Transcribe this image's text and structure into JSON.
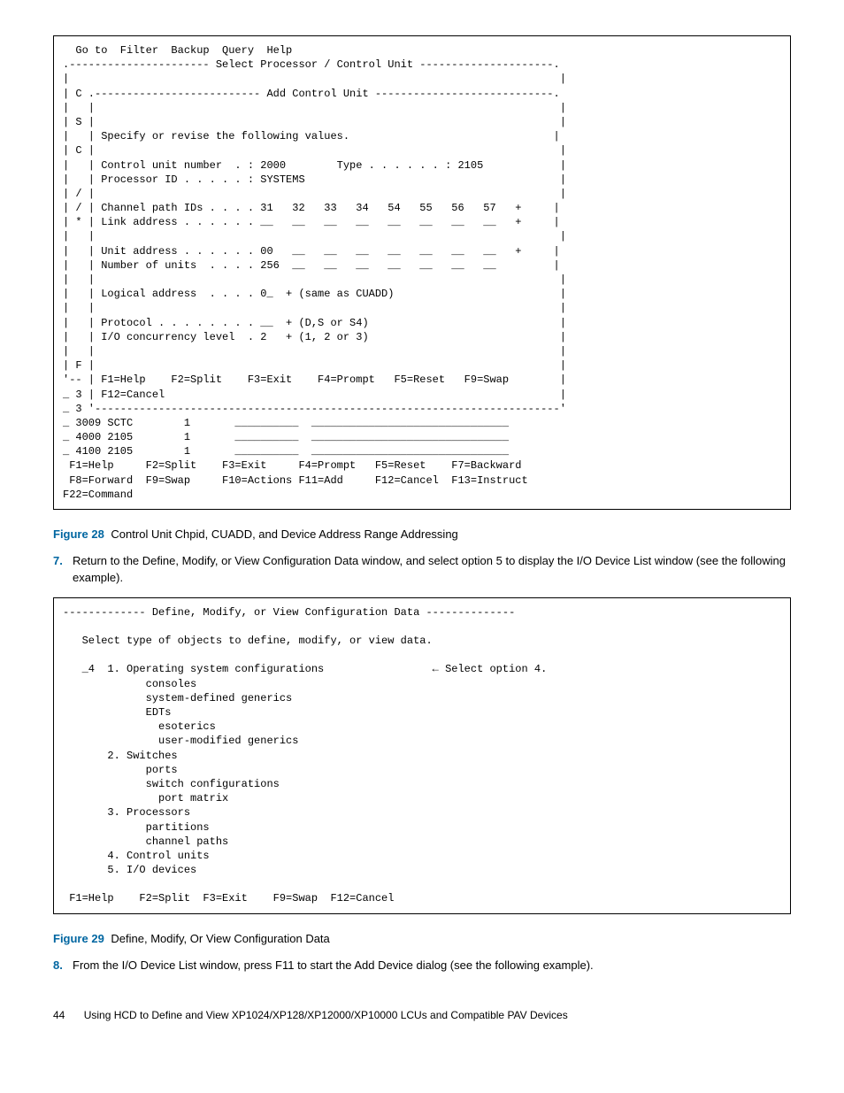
{
  "figure28": {
    "content": "  Go to  Filter  Backup  Query  Help\n.---------------------- Select Processor / Control Unit ---------------------.\n|                                                                             |\n| C .-------------------------- Add Control Unit ----------------------------.\n|   |                                                                         |\n| S |                                                                         |\n|   | Specify or revise the following values.                                |\n| C |                                                                         |\n|   | Control unit number  . : 2000        Type . . . . . . : 2105            |\n|   | Processor ID . . . . . : SYSTEMS                                        |\n| / |                                                                         |\n| / | Channel path IDs . . . . 31   32   33   34   54   55   56   57   +     |\n| * | Link address . . . . . . __   __   __   __   __   __   __   __   +     |\n|   |                                                                         |\n|   | Unit address . . . . . . 00   __   __   __   __   __   __   __   +     |\n|   | Number of units  . . . . 256  __   __   __   __   __   __   __         |\n|   |                                                                         |\n|   | Logical address  . . . . 0_  + (same as CUADD)                          |\n|   |                                                                         |\n|   | Protocol . . . . . . . . __  + (D,S or S4)                              |\n|   | I/O concurrency level  . 2   + (1, 2 or 3)                              |\n|   |                                                                         |\n| F |                                                                         |\n'-- | F1=Help    F2=Split    F3=Exit    F4=Prompt   F5=Reset   F9=Swap        |\n_ 3 | F12=Cancel                                                              |\n_ 3 '-------------------------------------------------------------------------'\n_ 3009 SCTC        1       __________  _______________________________\n_ 4000 2105        1       __________  _______________________________\n_ 4100 2105        1       __________  _______________________________\n F1=Help     F2=Split    F3=Exit     F4=Prompt   F5=Reset    F7=Backward\n F8=Forward  F9=Swap     F10=Actions F11=Add     F12=Cancel  F13=Instruct\nF22=Command",
    "label": "Figure 28",
    "caption": "Control Unit Chpid, CUADD, and Device Address Range Addressing"
  },
  "step7": {
    "number": "7.",
    "text": "Return to the Define, Modify, or View Configuration Data window, and select option 5 to display the I/O Device List window (see the following example)."
  },
  "figure29": {
    "content": "------------- Define, Modify, or View Configuration Data --------------\n\n   Select type of objects to define, modify, or view data.\n\n   _4  1. Operating system configurations                 ← Select option 4.\n             consoles\n             system-defined generics\n             EDTs\n               esoterics\n               user-modified generics\n       2. Switches\n             ports\n             switch configurations\n               port matrix\n       3. Processors\n             partitions\n             channel paths\n       4. Control units\n       5. I/O devices\n\n F1=Help    F2=Split  F3=Exit    F9=Swap  F12=Cancel",
    "label": "Figure 29",
    "caption": "Define, Modify, Or View Configuration Data"
  },
  "step8": {
    "number": "8.",
    "text": "From the I/O Device List window, press F11 to start the Add Device dialog (see the following example)."
  },
  "footer": {
    "page_number": "44",
    "section_title": "Using HCD to Define and View XP1024/XP128/XP12000/XP10000 LCUs and Compatible PAV Devices"
  }
}
